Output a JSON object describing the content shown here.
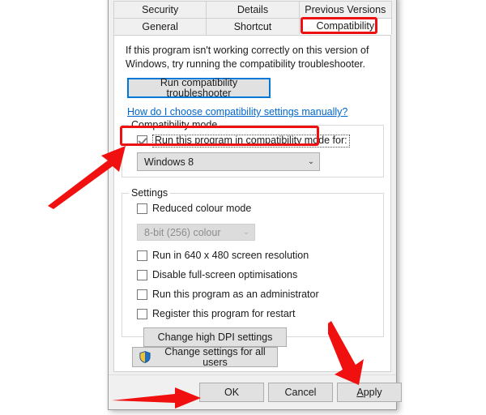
{
  "dialog": {
    "tabs_row1": [
      {
        "label": "Security",
        "selected": false
      },
      {
        "label": "Details",
        "selected": false
      },
      {
        "label": "Previous Versions",
        "selected": false
      }
    ],
    "tabs_row2": [
      {
        "label": "General",
        "selected": false
      },
      {
        "label": "Shortcut",
        "selected": false
      },
      {
        "label": "Compatibility",
        "selected": true
      }
    ],
    "intro_text": "If this program isn't working correctly on this version of Windows, try running the compatibility troubleshooter.",
    "troubleshoot_button": "Run compatibility troubleshooter",
    "help_link": "How do I choose compatibility settings manually?",
    "compatibility_mode": {
      "group_title": "Compatibility mode",
      "checkbox_label": "Run this program in compatibility mode for:",
      "checkbox_checked": true,
      "os_select_value": "Windows 8",
      "chevron": "⌄"
    },
    "settings": {
      "group_title": "Settings",
      "reduced_colour_label": "Reduced colour mode",
      "reduced_colour_checked": false,
      "colour_depth_value": "8-bit (256) colour",
      "colour_depth_disabled": true,
      "chevron": "⌄",
      "checkboxes": [
        {
          "label": "Run in 640 x 480 screen resolution",
          "checked": false
        },
        {
          "label": "Disable full-screen optimisations",
          "checked": false
        },
        {
          "label": "Run this program as an administrator",
          "checked": false
        },
        {
          "label": "Register this program for restart",
          "checked": false
        }
      ],
      "dpi_button": "Change high DPI settings"
    },
    "all_users_button": "Change settings for all users",
    "buttons": {
      "ok": "OK",
      "cancel": "Cancel",
      "apply_accel": "A",
      "apply_rest": "pply"
    }
  },
  "annotations": {
    "highlight_color": "#ee1111",
    "arrow_color": "#f01010",
    "arrow_compat_checkbox": "arrow-pointing-to-compatibility-checkbox",
    "arrow_ok": "arrow-pointing-to-ok-button",
    "arrow_apply": "arrow-pointing-to-apply-button",
    "highlight_compat_tab": "red-box-around-compatibility-tab",
    "highlight_compat_checkbox": "red-box-around-run-this-program-checkbox"
  }
}
